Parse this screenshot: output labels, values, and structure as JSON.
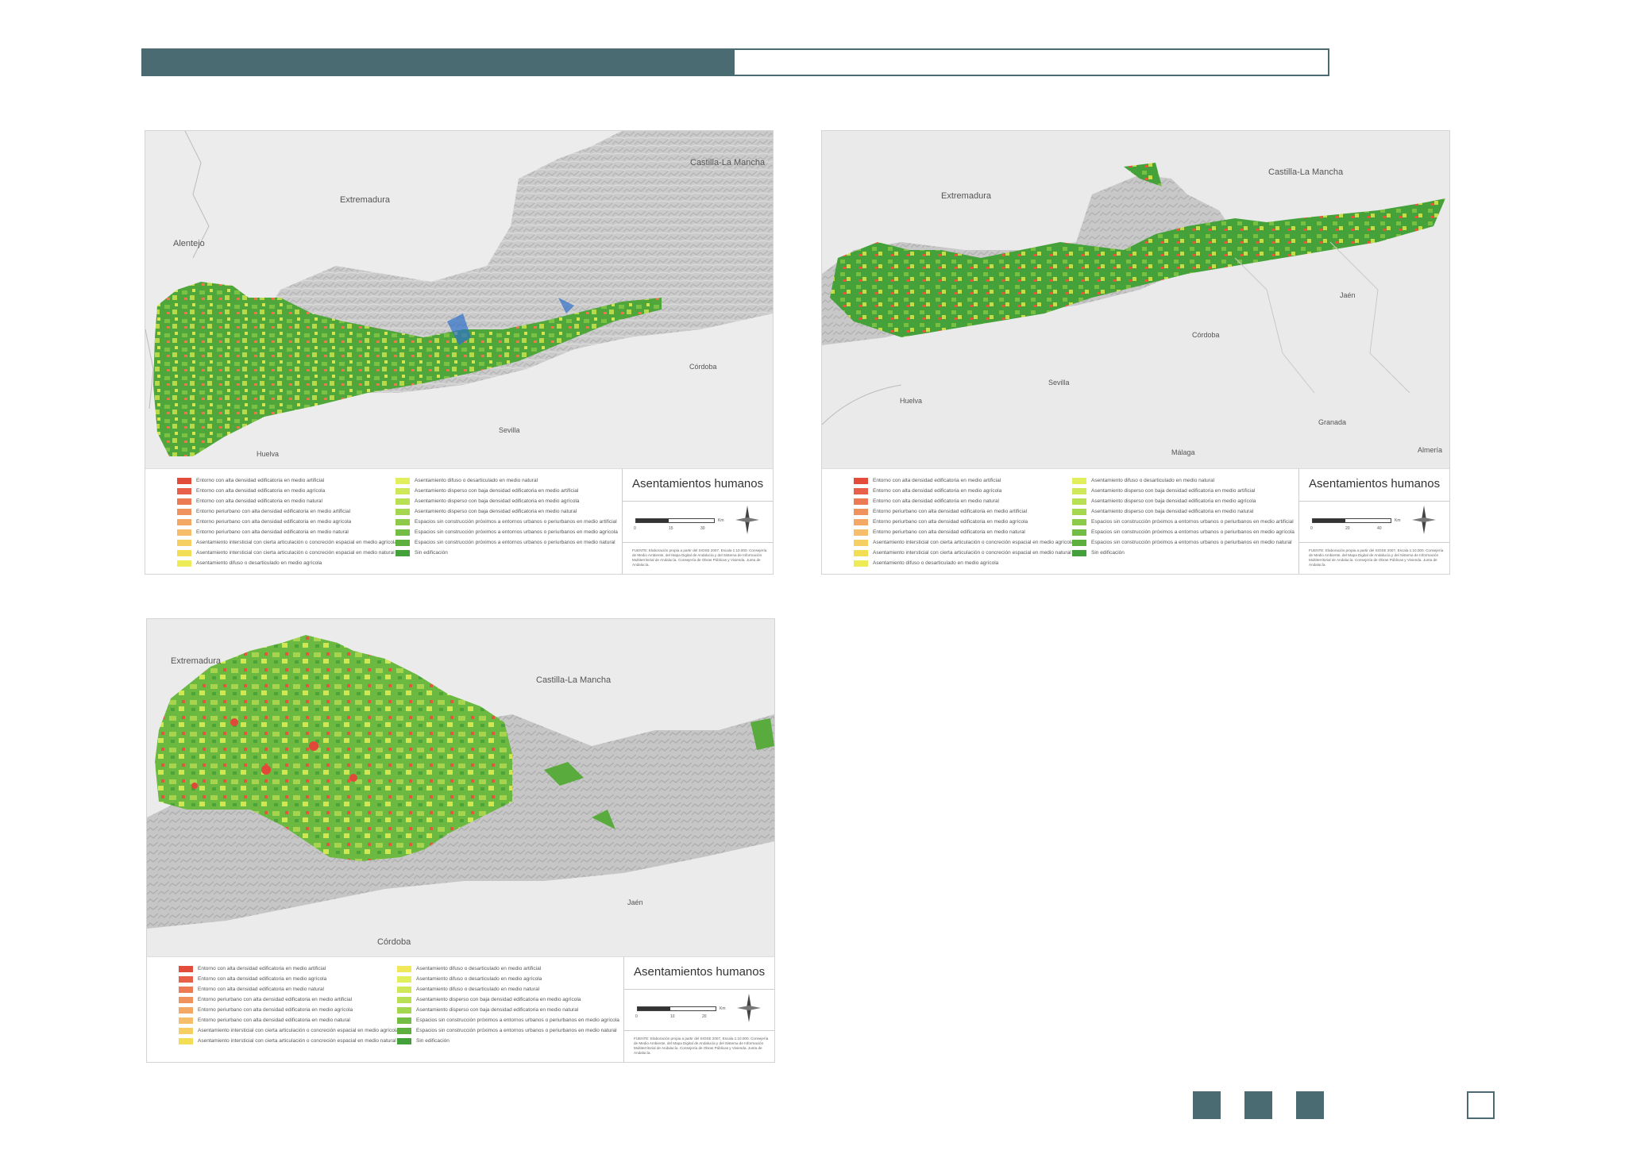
{
  "panels": [
    {
      "place_labels": [
        "Extremadura",
        "Castilla-La Mancha",
        "Alentejo",
        "Córdoba",
        "Sevilla",
        "Huelva"
      ],
      "legend": [
        {
          "label": "Entorno con alta densidad edificatoria en medio artificial",
          "color": "#e34b3a"
        },
        {
          "label": "Entorno con alta densidad edificatoria en medio agrícola",
          "color": "#e8604a"
        },
        {
          "label": "Entorno con alta densidad edificatoria en medio natural",
          "color": "#ec7a55"
        },
        {
          "label": "Entorno periurbano con alta densidad edificatoria en medio artificial",
          "color": "#f0925d"
        },
        {
          "label": "Entorno periurbano con alta densidad edificatoria en medio agrícola",
          "color": "#f3a865"
        },
        {
          "label": "Entorno periurbano con alta densidad edificatoria en medio natural",
          "color": "#f6bd6a"
        },
        {
          "label": "Asentamiento intersticial con cierta articulación o concreción espacial en medio agrícola",
          "color": "#f6cf62"
        },
        {
          "label": "Asentamiento intersticial con cierta articulación o concreción espacial en medio natural",
          "color": "#f2de55"
        },
        {
          "label": "Asentamiento difuso o desarticulado en medio agrícola",
          "color": "#eeec56"
        },
        {
          "label": "Asentamiento difuso o desarticulado en medio natural",
          "color": "#e2ef5c"
        },
        {
          "label": "Asentamiento disperso con baja densidad edificatoria en medio artificial",
          "color": "#cfe85a"
        },
        {
          "label": "Asentamiento disperso con baja densidad edificatoria en medio agrícola",
          "color": "#b9df55"
        },
        {
          "label": "Asentamiento disperso con baja densidad edificatoria en medio natural",
          "color": "#a4d650"
        },
        {
          "label": "Espacios sin construcción próximos a entornos urbanos o periurbanos en medio artificial",
          "color": "#8dca4a"
        },
        {
          "label": "Espacios sin construcción próximos a entornos urbanos o periurbanos en medio agrícola",
          "color": "#74bd44"
        },
        {
          "label": "Espacios sin construcción próximos a entornos urbanos o periurbanos en medio natural",
          "color": "#5daf3e"
        },
        {
          "label": "Sin edificación",
          "color": "#43a03a"
        }
      ],
      "title": "Asentamientos humanos",
      "scale_ticks": [
        "0",
        "15",
        "30"
      ],
      "scale_unit": "Km",
      "source": "FUENTE: Elaboración propia a partir del SIOSE 2007, Escala 1:10.000. Consejería de Medio Ambiente, del Mapa Digital de Andalucía y del Sistema de Información Multiterritorial de Andalucía. Consejería de Obras Públicas y Vivienda. Junta de Andalucía."
    },
    {
      "place_labels": [
        "Extremadura",
        "Castilla-La Mancha",
        "Jaén",
        "Córdoba",
        "Sevilla",
        "Huelva",
        "Granada",
        "Málaga",
        "Almería"
      ],
      "legend": [
        {
          "label": "Entorno con alta densidad edificatoria en medio artificial",
          "color": "#e34b3a"
        },
        {
          "label": "Entorno con alta densidad edificatoria en medio agrícola",
          "color": "#e8604a"
        },
        {
          "label": "Entorno con alta densidad edificatoria en medio natural",
          "color": "#ec7a55"
        },
        {
          "label": "Entorno periurbano con alta densidad edificatoria en medio artificial",
          "color": "#f0925d"
        },
        {
          "label": "Entorno periurbano con alta densidad edificatoria en medio agrícola",
          "color": "#f3a865"
        },
        {
          "label": "Entorno periurbano con alta densidad edificatoria en medio natural",
          "color": "#f6bd6a"
        },
        {
          "label": "Asentamiento intersticial con cierta articulación o concreción espacial en medio agrícola",
          "color": "#f6cf62"
        },
        {
          "label": "Asentamiento intersticial con cierta articulación o concreción espacial en medio natural",
          "color": "#f2de55"
        },
        {
          "label": "Asentamiento difuso o desarticulado en medio agrícola",
          "color": "#eeec56"
        },
        {
          "label": "Asentamiento difuso o desarticulado en medio natural",
          "color": "#e2ef5c"
        },
        {
          "label": "Asentamiento disperso con baja densidad edificatoria en medio artificial",
          "color": "#cfe85a"
        },
        {
          "label": "Asentamiento disperso con baja densidad edificatoria en medio agrícola",
          "color": "#b9df55"
        },
        {
          "label": "Asentamiento disperso con baja densidad edificatoria en medio natural",
          "color": "#a4d650"
        },
        {
          "label": "Espacios sin construcción próximos a entornos urbanos o periurbanos en medio artificial",
          "color": "#8dca4a"
        },
        {
          "label": "Espacios sin construcción próximos a entornos urbanos o periurbanos en medio agrícola",
          "color": "#74bd44"
        },
        {
          "label": "Espacios sin construcción próximos a entornos urbanos o periurbanos en medio natural",
          "color": "#5daf3e"
        },
        {
          "label": "Sin edificación",
          "color": "#43a03a"
        }
      ],
      "title": "Asentamientos humanos",
      "scale_ticks": [
        "0",
        "20",
        "40"
      ],
      "scale_unit": "Km",
      "source": "FUENTE: Elaboración propia a partir del SIOSE 2007, Escala 1:10.000. Consejería de Medio Ambiente, del Mapa Digital de Andalucía y del Sistema de Información Multiterritorial de Andalucía. Consejería de Obras Públicas y Vivienda. Junta de Andalucía."
    },
    {
      "place_labels": [
        "Extremadura",
        "Castilla-La Mancha",
        "Jaén",
        "Córdoba"
      ],
      "legend": [
        {
          "label": "Entorno con alta densidad edificatoria en medio artificial",
          "color": "#e34b3a"
        },
        {
          "label": "Entorno con alta densidad edificatoria en medio agrícola",
          "color": "#e8604a"
        },
        {
          "label": "Entorno con alta densidad edificatoria en medio natural",
          "color": "#ec7a55"
        },
        {
          "label": "Entorno periurbano con alta densidad edificatoria en medio artificial",
          "color": "#f0925d"
        },
        {
          "label": "Entorno periurbano con alta densidad edificatoria en medio agrícola",
          "color": "#f3a865"
        },
        {
          "label": "Entorno periurbano con alta densidad edificatoria en medio natural",
          "color": "#f6bd6a"
        },
        {
          "label": "Asentamiento intersticial con cierta articulación o concreción espacial en medio agrícola",
          "color": "#f6cf62"
        },
        {
          "label": "Asentamiento intersticial con cierta articulación o concreción espacial en medio natural",
          "color": "#f2de55"
        },
        {
          "label": "Asentamiento difuso o desarticulado en medio artificial",
          "color": "#f0e859"
        },
        {
          "label": "Asentamiento difuso o desarticulado en medio agrícola",
          "color": "#e2ef5c"
        },
        {
          "label": "Asentamiento difuso o desarticulado en medio natural",
          "color": "#cfe85a"
        },
        {
          "label": "Asentamiento disperso con baja densidad edificatoria en medio agrícola",
          "color": "#b9df55"
        },
        {
          "label": "Asentamiento disperso con baja densidad edificatoria en medio natural",
          "color": "#a4d650"
        },
        {
          "label": "Espacios sin construcción próximos a entornos urbanos o periurbanos en medio agrícola",
          "color": "#74bd44"
        },
        {
          "label": "Espacios sin construcción próximos a entornos urbanos o periurbanos en medio natural",
          "color": "#5daf3e"
        },
        {
          "label": "Sin edificación",
          "color": "#43a03a"
        }
      ],
      "title": "Asentamientos humanos",
      "scale_ticks": [
        "0",
        "10",
        "20"
      ],
      "scale_unit": "Km",
      "source": "FUENTE: Elaboración propia a partir del SIOSE 2007, Escala 1:10.000. Consejería de Medio Ambiente, del Mapa Digital de Andalucía y del Sistema de Información Multiterritorial de Andalucía. Consejería de Obras Públicas y Vivienda. Junta de Andalucía."
    }
  ],
  "colors": {
    "accent": "#4a6b72",
    "terrain": "#c9c9c9",
    "land": "#e9e9e9",
    "veg_dark": "#43a03a",
    "veg_mid": "#7cc142",
    "veg_light": "#c8e04a",
    "urban": "#e0483a",
    "water": "#2f6fc9"
  }
}
